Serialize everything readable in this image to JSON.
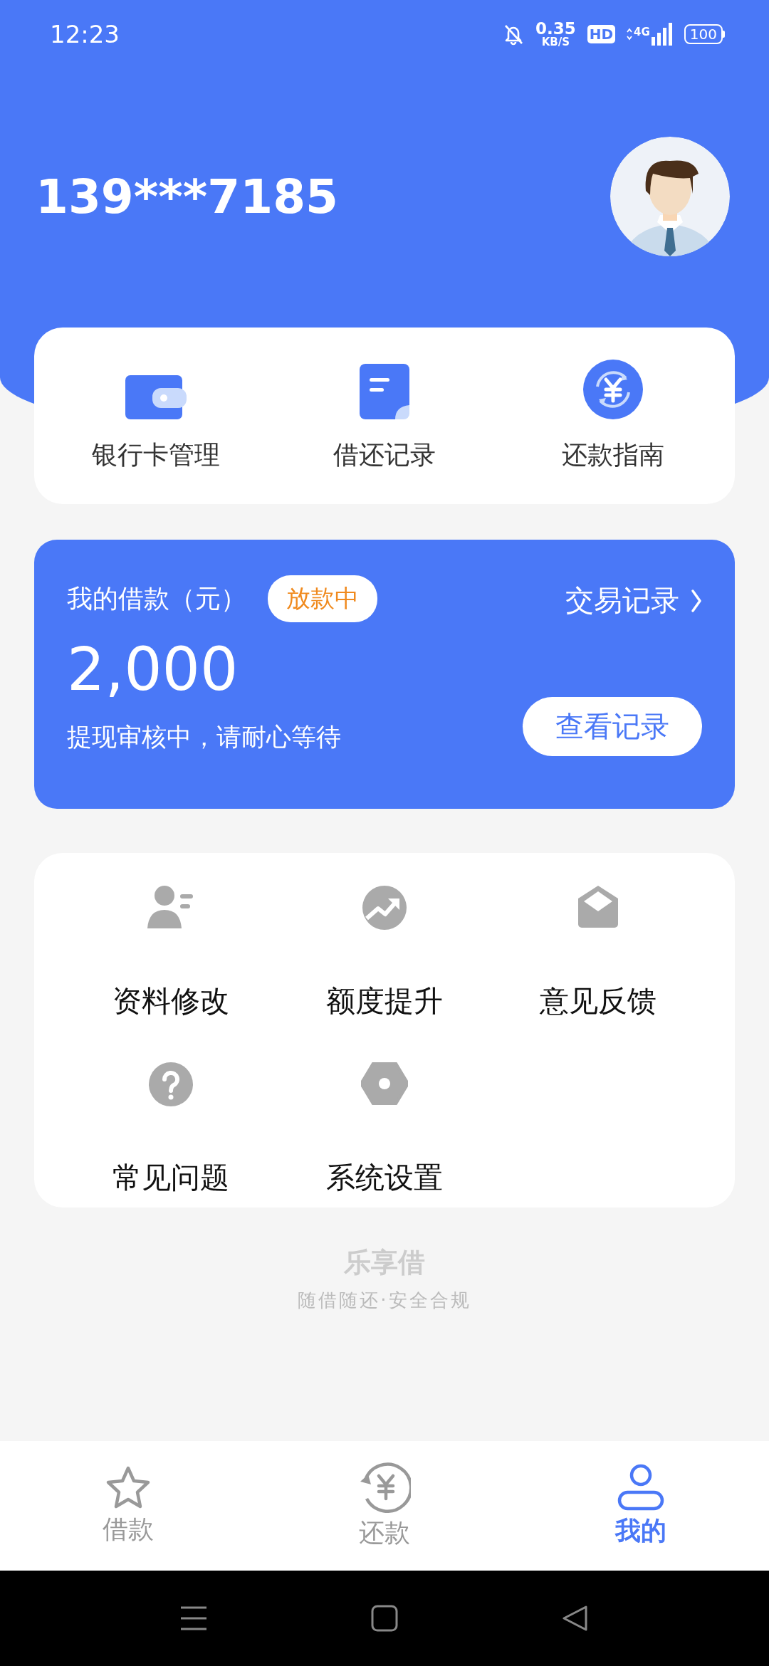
{
  "status_bar": {
    "time": "12:23",
    "net_speed": "0.35",
    "net_speed_unit": "KB/S",
    "hd": "HD",
    "network": "4G",
    "battery": "100"
  },
  "profile": {
    "phone": "139***7185"
  },
  "quick_actions": [
    {
      "label": "银行卡管理"
    },
    {
      "label": "借还记录"
    },
    {
      "label": "还款指南"
    }
  ],
  "loan_card": {
    "title": "我的借款（元）",
    "status": "放款中",
    "link": "交易记录",
    "amount": "2,000",
    "note": "提现审核中，请耐心等待",
    "button": "查看记录"
  },
  "menu": [
    {
      "label": "资料修改"
    },
    {
      "label": "额度提升"
    },
    {
      "label": "意见反馈"
    },
    {
      "label": "常见问题"
    },
    {
      "label": "系统设置"
    }
  ],
  "footer": {
    "brand": "乐享借",
    "slogan": "随借随还·安全合规"
  },
  "tabs": [
    {
      "label": "借款",
      "selected": false
    },
    {
      "label": "还款",
      "selected": false
    },
    {
      "label": "我的",
      "selected": true
    }
  ]
}
